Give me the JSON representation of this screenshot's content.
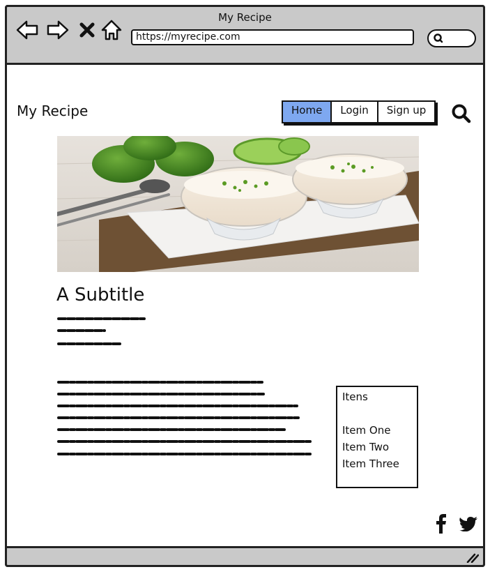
{
  "browser": {
    "window_title": "My Recipe",
    "url": "https://myrecipe.com",
    "back_icon": "back-arrow-icon",
    "forward_icon": "forward-arrow-icon",
    "stop_icon": "close-icon",
    "home_icon": "home-icon",
    "search_icon": "search-icon"
  },
  "header": {
    "brand": "My Recipe",
    "nav": [
      {
        "label": "Home",
        "active": true
      },
      {
        "label": "Login",
        "active": false
      },
      {
        "label": "Sign up",
        "active": false
      }
    ],
    "active_color": "#7ea8f0"
  },
  "hero": {
    "icon": "recipe-photo"
  },
  "content": {
    "subtitle": "A Subtitle"
  },
  "sidebar": {
    "title": "Itens",
    "items": [
      "Item One",
      "Item Two",
      "Item Three"
    ]
  },
  "footer": {
    "social": [
      "facebook-icon",
      "twitter-icon"
    ]
  }
}
